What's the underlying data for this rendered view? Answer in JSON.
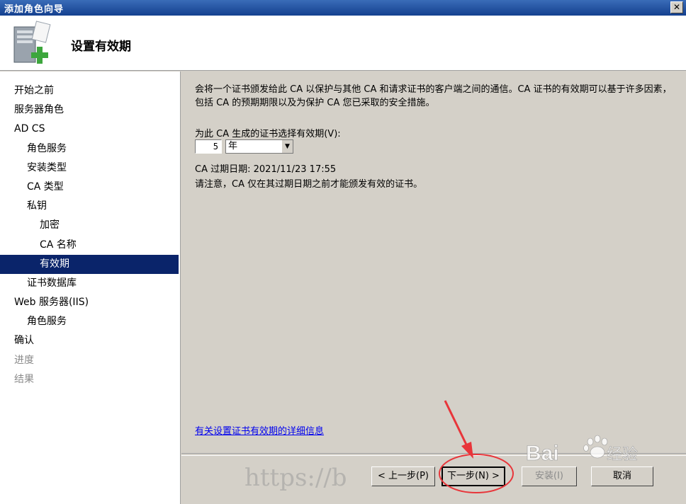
{
  "window": {
    "title": "添加角色向导",
    "close_glyph": "✕"
  },
  "header": {
    "title": "设置有效期",
    "icon": "server-add-icon"
  },
  "sidebar": {
    "items": [
      {
        "label": "开始之前",
        "level": 0,
        "state": "normal"
      },
      {
        "label": "服务器角色",
        "level": 0,
        "state": "normal"
      },
      {
        "label": "AD CS",
        "level": 0,
        "state": "normal"
      },
      {
        "label": "角色服务",
        "level": 1,
        "state": "normal"
      },
      {
        "label": "安装类型",
        "level": 1,
        "state": "normal"
      },
      {
        "label": "CA 类型",
        "level": 1,
        "state": "normal"
      },
      {
        "label": "私钥",
        "level": 1,
        "state": "normal"
      },
      {
        "label": "加密",
        "level": 2,
        "state": "normal"
      },
      {
        "label": "CA 名称",
        "level": 2,
        "state": "normal"
      },
      {
        "label": "有效期",
        "level": 2,
        "state": "selected"
      },
      {
        "label": "证书数据库",
        "level": 1,
        "state": "normal"
      },
      {
        "label": "Web 服务器(IIS)",
        "level": 0,
        "state": "normal"
      },
      {
        "label": "角色服务",
        "level": 1,
        "state": "normal"
      },
      {
        "label": "确认",
        "level": 0,
        "state": "normal"
      },
      {
        "label": "进度",
        "level": 0,
        "state": "disabled"
      },
      {
        "label": "结果",
        "level": 0,
        "state": "disabled"
      }
    ]
  },
  "main": {
    "description": "会将一个证书颁发给此 CA 以保护与其他 CA 和请求证书的客户端之间的通信。CA 证书的有效期可以基于许多因素，包括 CA 的预期期限以及为保护 CA 您已采取的安全措施。",
    "period_label": "为此 CA 生成的证书选择有效期(V):",
    "period_value": "5",
    "period_unit": "年",
    "expiry_label": "CA 过期日期:",
    "expiry_value": "2021/11/23 17:55",
    "note": "请注意，CA 仅在其过期日期之前才能颁发有效的证书。",
    "help_link": "有关设置证书有效期的详细信息"
  },
  "buttons": {
    "back": "< 上一步(P)",
    "next": "下一步(N) >",
    "install": "安装(I)",
    "cancel": "取消"
  },
  "watermarks": {
    "url_text": "https://b",
    "brand_text": "Bai",
    "brand_suffix": "经验"
  },
  "colors": {
    "title_bar": "#1b4b9a",
    "selection": "#0a246a",
    "annotation": "#e8353a",
    "link": "#0000ee"
  }
}
